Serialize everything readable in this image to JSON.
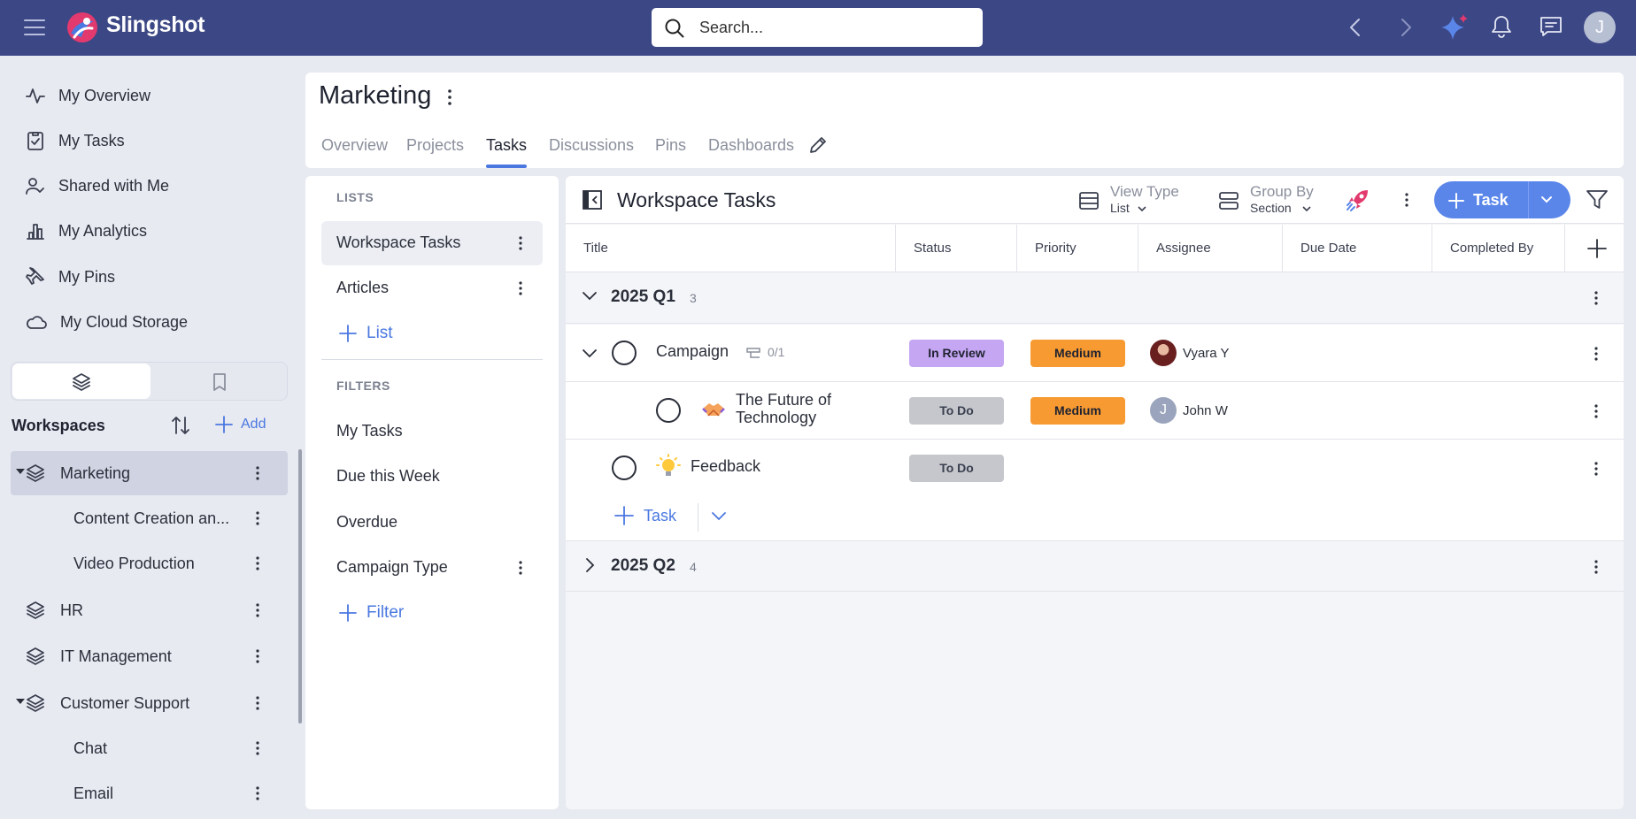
{
  "app": {
    "name": "Slingshot"
  },
  "topbar": {
    "search_placeholder": "Search...",
    "user_initial": "J"
  },
  "nav": {
    "items": [
      {
        "label": "My Overview",
        "icon": "activity-icon"
      },
      {
        "label": "My Tasks",
        "icon": "clipboard-check-icon"
      },
      {
        "label": "Shared with Me",
        "icon": "user-check-icon"
      },
      {
        "label": "My Analytics",
        "icon": "bar-chart-icon"
      },
      {
        "label": "My Pins",
        "icon": "pin-icon"
      },
      {
        "label": "My Cloud Storage",
        "icon": "cloud-icon"
      }
    ]
  },
  "workspaces": {
    "heading": "Workspaces",
    "add_label": "Add",
    "items": [
      {
        "label": "Marketing"
      },
      {
        "label": "Content Creation an..."
      },
      {
        "label": "Video Production"
      },
      {
        "label": "HR"
      },
      {
        "label": "IT Management"
      },
      {
        "label": "Customer Support"
      },
      {
        "label": "Chat"
      },
      {
        "label": "Email"
      }
    ]
  },
  "header": {
    "title": "Marketing",
    "tabs": [
      "Overview",
      "Projects",
      "Tasks",
      "Discussions",
      "Pins",
      "Dashboards"
    ],
    "active_tab": "Tasks"
  },
  "lists_panel": {
    "lists_heading": "LISTS",
    "lists": [
      "Workspace Tasks",
      "Articles"
    ],
    "add_list_label": "List",
    "filters_heading": "FILTERS",
    "filters": [
      "My Tasks",
      "Due this Week",
      "Overdue",
      "Campaign Type"
    ],
    "add_filter_label": "Filter"
  },
  "tasks": {
    "title": "Workspace Tasks",
    "view_type": {
      "label": "View Type",
      "value": "List"
    },
    "group_by": {
      "label": "Group By",
      "value": "Section"
    },
    "new_task_label": "Task",
    "columns": [
      "Title",
      "Status",
      "Priority",
      "Assignee",
      "Due Date",
      "Completed By"
    ],
    "groups": [
      {
        "name": "2025 Q1",
        "count": "3"
      },
      {
        "name": "2025 Q2",
        "count": "4"
      }
    ],
    "rows": [
      {
        "title": "Campaign",
        "subtasks": "0/1",
        "status": "In Review",
        "priority": "Medium",
        "assignee": "Vyara Y"
      },
      {
        "title_line1": "The Future of",
        "title_line2": "Technology",
        "status": "To Do",
        "priority": "Medium",
        "assignee": "John W",
        "assignee_initial": "J"
      },
      {
        "title": "Feedback",
        "status": "To Do"
      }
    ],
    "add_task_label": "Task"
  },
  "colors": {
    "topbar": "#3c4785",
    "accent": "#5a86ea",
    "in_review": "#c5a6f2",
    "to_do": "#c5c7cc",
    "medium": "#f79a32"
  }
}
